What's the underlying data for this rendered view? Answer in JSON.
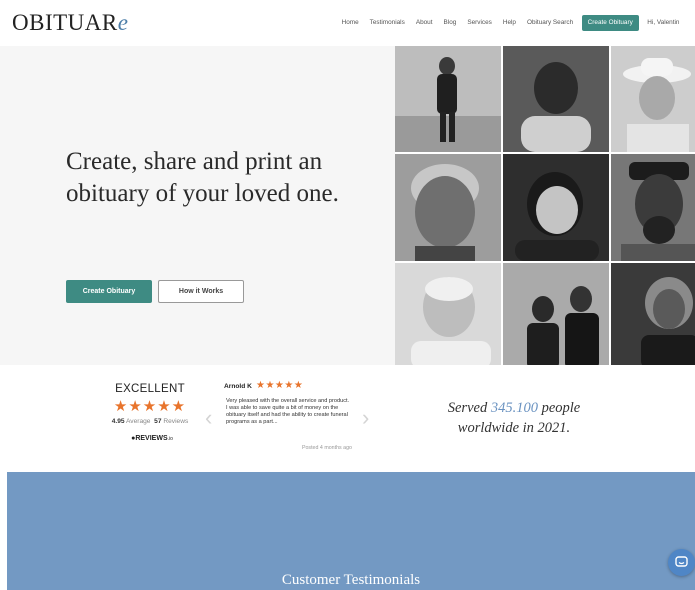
{
  "brand": {
    "logo_main": "OBITUAR",
    "logo_accent": "e"
  },
  "nav": {
    "items": [
      "Home",
      "Testimonials",
      "About",
      "Blog",
      "Services",
      "Help",
      "Obituary Search"
    ],
    "cta": "Create Obituary",
    "user": "Hi, Valentin"
  },
  "hero": {
    "title": "Create, share and print an obituary of your loved one.",
    "primary_button": "Create Obituary",
    "secondary_button": "How it Works"
  },
  "reviews": {
    "rating_word": "EXCELLENT",
    "stars": "★★★★★",
    "average_value": "4.95",
    "average_label": "Average",
    "count_value": "57",
    "count_label": "Reviews",
    "badge_main": "REVIEWS",
    "badge_suffix": ".io",
    "reviewer_name": "Arnold K",
    "reviewer_stars": "★★★★★",
    "review_text": "Very pleased with the overall service and product. I was able to save quite a bit of money on the obituary itself and had the ability to create funeral programs as a part...",
    "posted": "Posted 4 months ago",
    "arrow_left": "‹",
    "arrow_right": "›"
  },
  "served": {
    "prefix": "Served ",
    "number": "345.100",
    "suffix_line1": " people",
    "line2": "worldwide in 2021."
  },
  "testimonials": {
    "title": "Customer Testimonials"
  },
  "colors": {
    "accent": "#3e8b83",
    "star": "#e8742c",
    "band": "#7399c3",
    "served_number": "#6b93c1",
    "chat": "#4f86c6"
  }
}
